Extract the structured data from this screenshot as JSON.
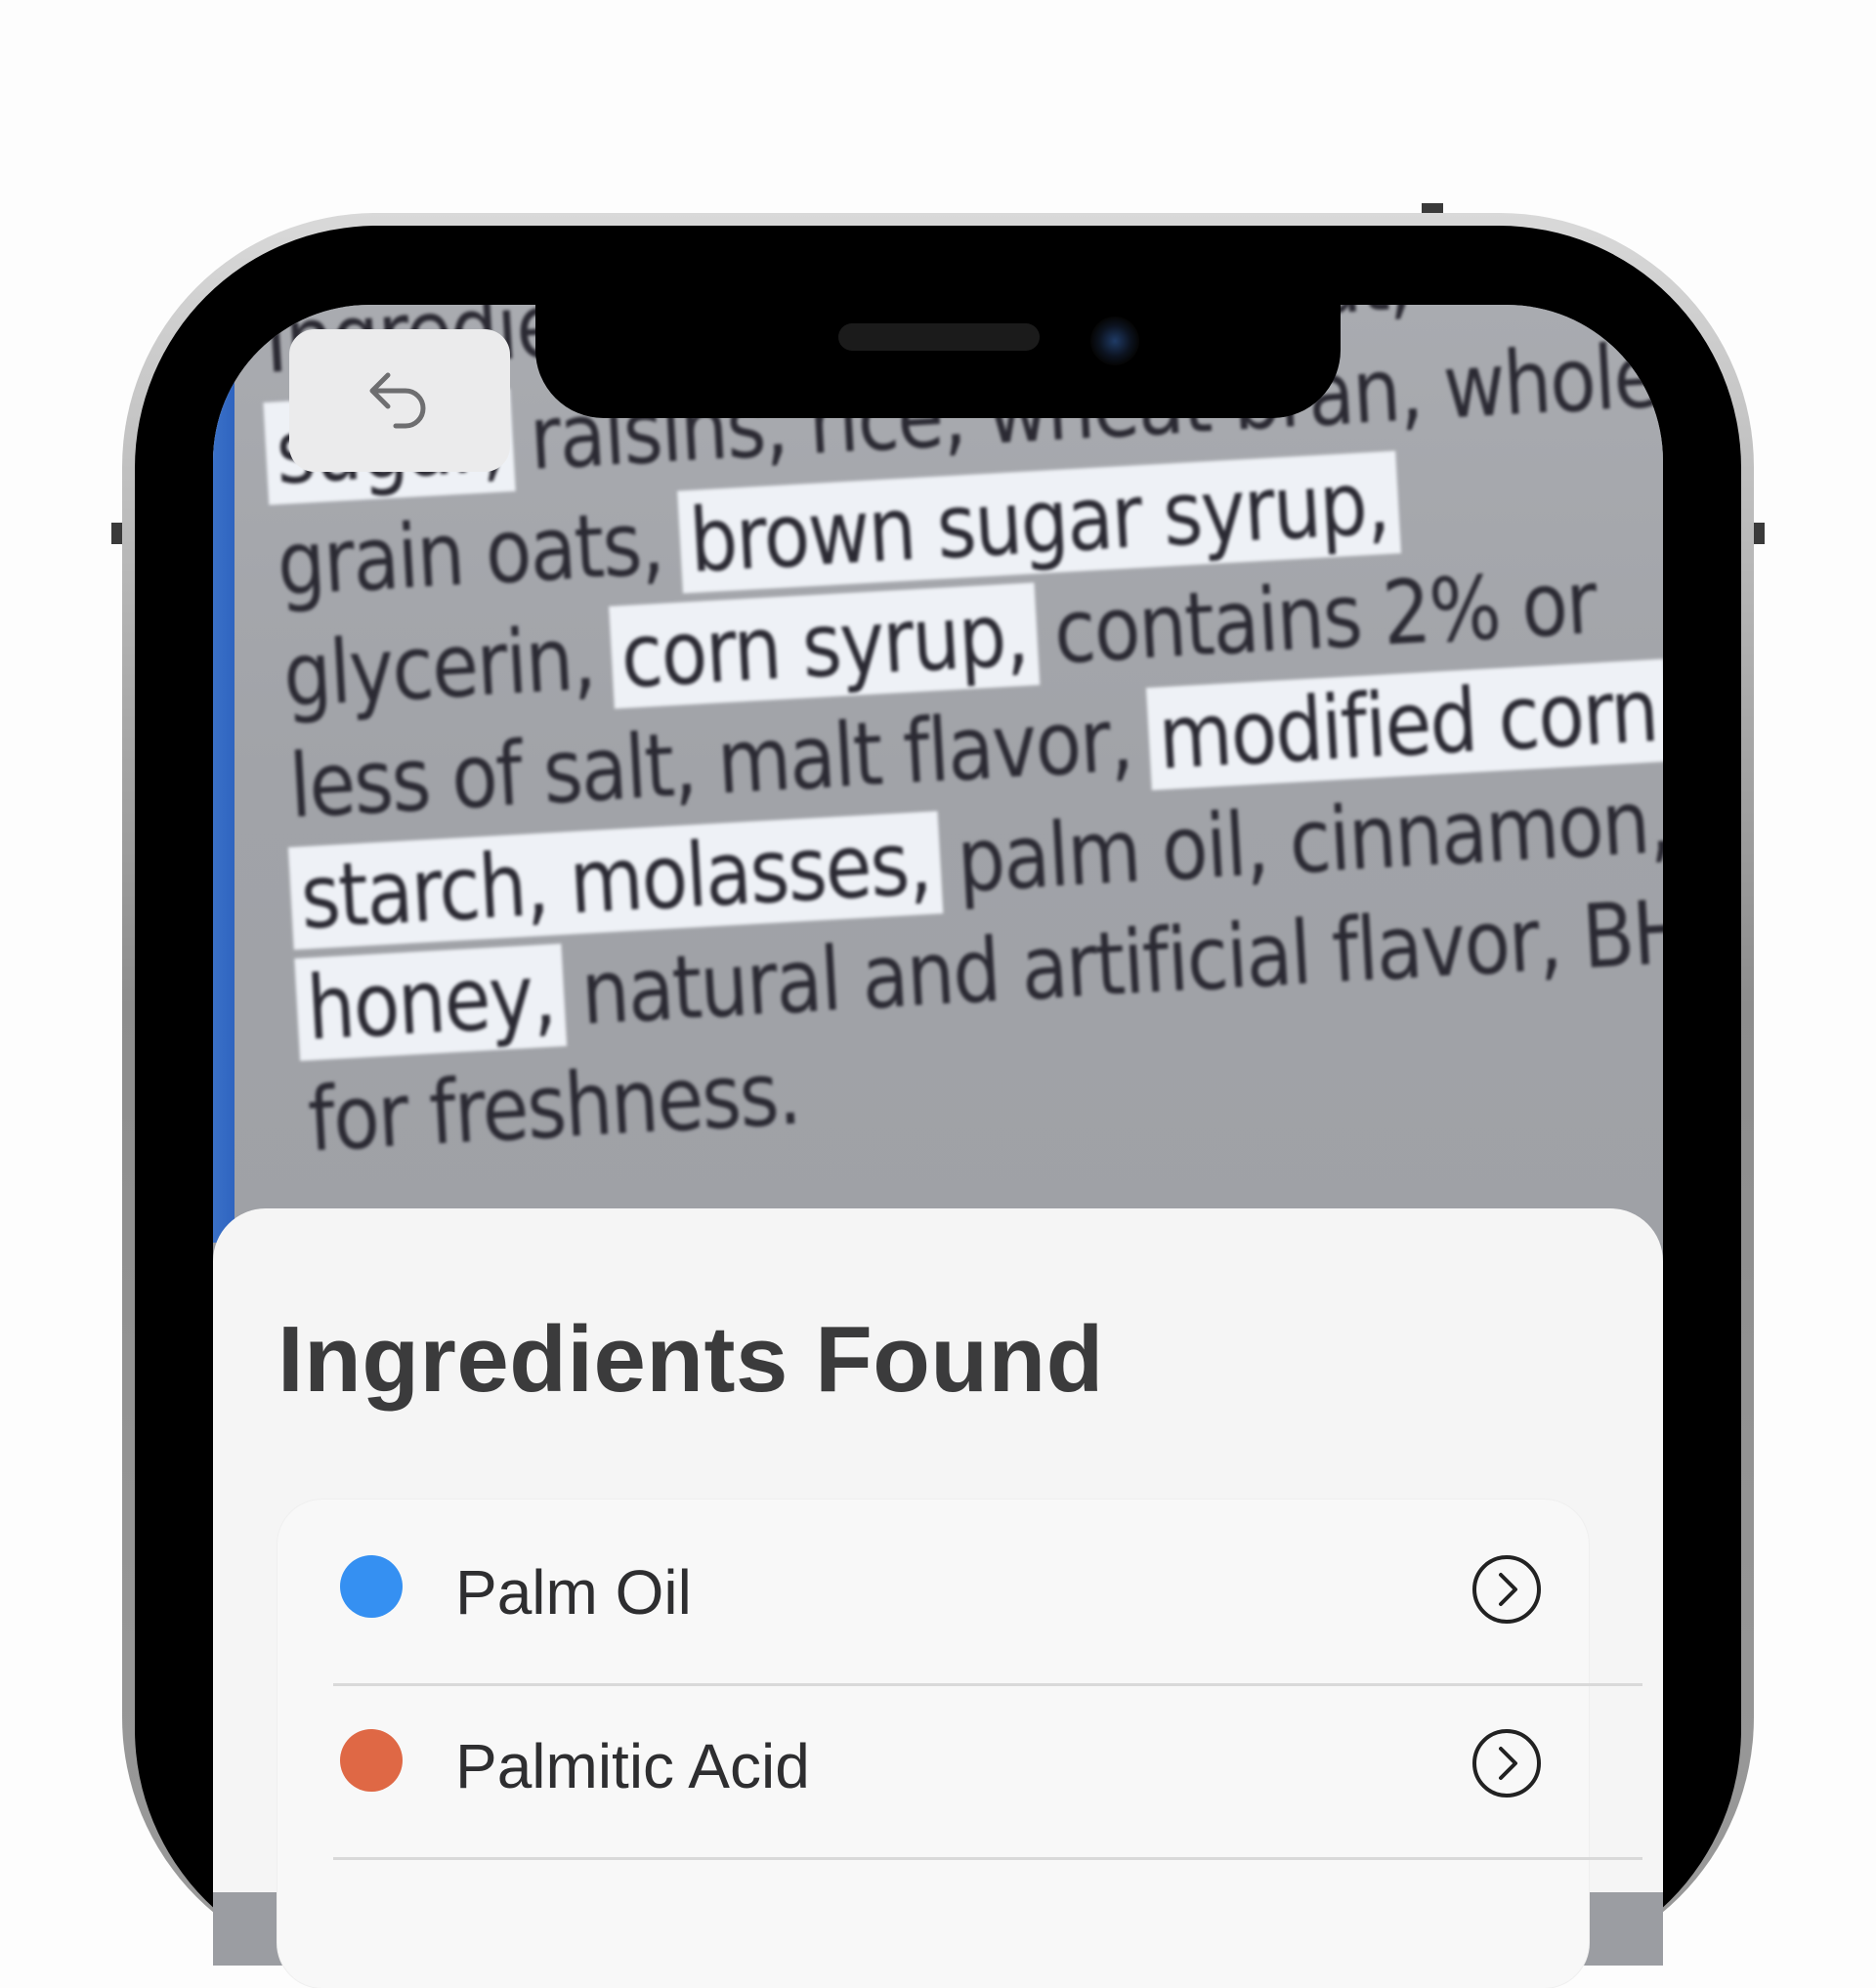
{
  "label_photo": {
    "lines": [
      {
        "segments": [
          {
            "text": "Ingredients: whole grain wheat,",
            "highlight": false
          }
        ]
      },
      {
        "segments": [
          {
            "text": "sugar,",
            "highlight": true
          },
          {
            "text": " raisins, rice, wheat bran, whole",
            "highlight": false
          }
        ]
      },
      {
        "segments": [
          {
            "text": "grain oats, ",
            "highlight": false
          },
          {
            "text": "brown sugar syrup,",
            "highlight": true
          }
        ]
      },
      {
        "segments": [
          {
            "text": "glycerin, ",
            "highlight": false
          },
          {
            "text": "corn syrup,",
            "highlight": true
          },
          {
            "text": " contains 2% or",
            "highlight": false
          }
        ]
      },
      {
        "segments": [
          {
            "text": "less of salt, malt flavor, ",
            "highlight": false
          },
          {
            "text": "modified corn",
            "highlight": true
          }
        ]
      },
      {
        "segments": [
          {
            "text": "starch, molasses,",
            "highlight": true
          },
          {
            "text": " palm oil, cinnamon,",
            "highlight": false
          }
        ]
      },
      {
        "segments": [
          {
            "text": "honey,",
            "highlight": true
          },
          {
            "text": " natural and artificial flavor, BHT",
            "highlight": false
          }
        ]
      },
      {
        "segments": [
          {
            "text": "for freshness.",
            "highlight": false
          }
        ]
      }
    ]
  },
  "back_button": {
    "icon": "undo-arrow-icon"
  },
  "sheet": {
    "title": "Ingredients Found",
    "items": [
      {
        "label": "Palm Oil",
        "dot_color": "#3590f2",
        "icon": "chevron-right-circle-icon"
      },
      {
        "label": "Palmitic Acid",
        "dot_color": "#df6845",
        "icon": "chevron-right-circle-icon"
      }
    ]
  },
  "colors": {
    "highlight": "#eef1f6",
    "sheet_background": "#f5f5f5",
    "title_text": "#3b3b3c"
  }
}
